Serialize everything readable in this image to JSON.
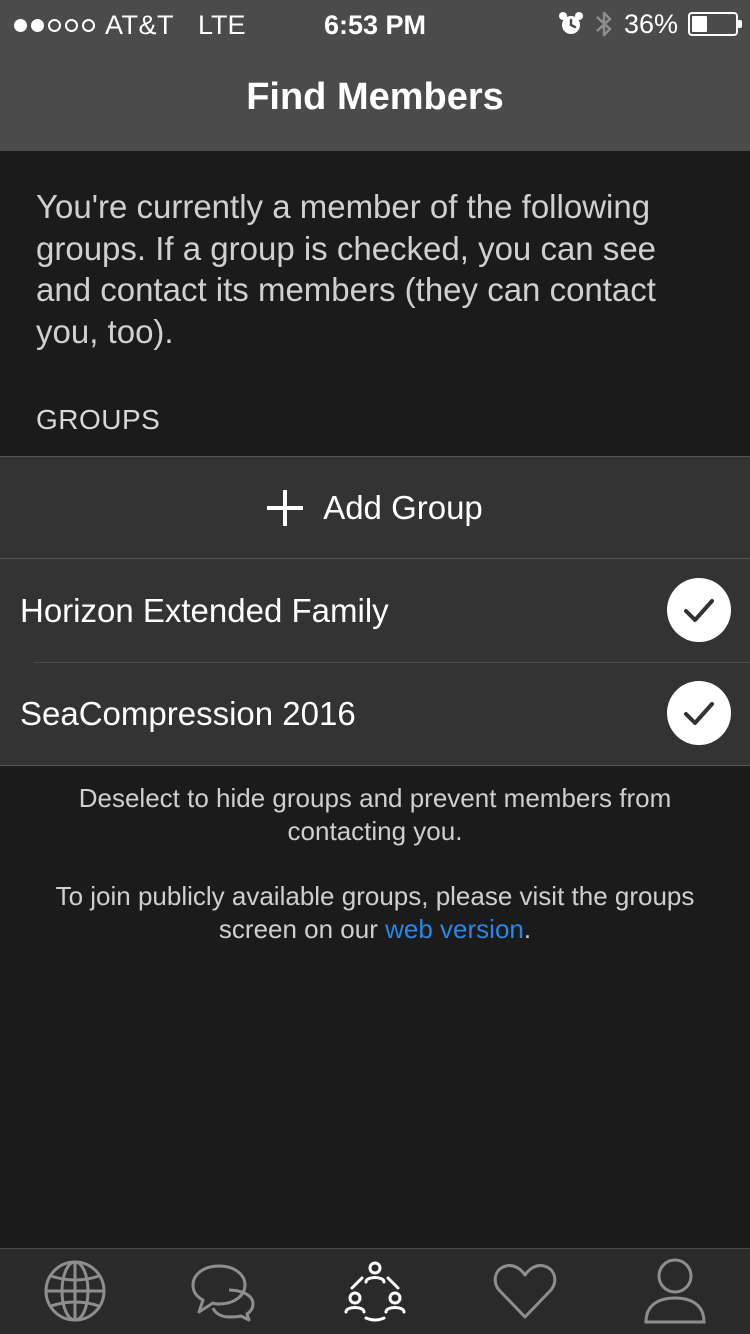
{
  "status_bar": {
    "carrier": "AT&T",
    "network": "LTE",
    "time": "6:53 PM",
    "battery_percent": "36%",
    "battery_level": 0.36,
    "signal_bars_filled": 2,
    "signal_bars_total": 5
  },
  "nav": {
    "title": "Find Members"
  },
  "intro_text": "You're currently a member of the following groups. If a group is checked, you can see and contact its members (they can contact you, too).",
  "section_header": "GROUPS",
  "add_group_label": "Add Group",
  "groups": [
    {
      "label": "Horizon Extended Family",
      "checked": true
    },
    {
      "label": "SeaCompression 2016",
      "checked": true
    }
  ],
  "footer": {
    "deselect_note": "Deselect to hide groups and prevent members from contacting you.",
    "join_note_prefix": "To join publicly available groups, please visit the groups screen on our",
    "join_link": "web version",
    "join_note_suffix": "."
  },
  "tabs": [
    {
      "icon": "globe-icon",
      "selected": false
    },
    {
      "icon": "chat-bubbles-icon",
      "selected": false
    },
    {
      "icon": "group-network-icon",
      "selected": true
    },
    {
      "icon": "heart-icon",
      "selected": false
    },
    {
      "icon": "profile-icon",
      "selected": false
    }
  ],
  "colors": {
    "background": "#1b1b1b",
    "nav_bar": "#4b4b4b",
    "list_row": "#333333",
    "link": "#2d86e6",
    "tab_bar": "#2a2a2a"
  }
}
